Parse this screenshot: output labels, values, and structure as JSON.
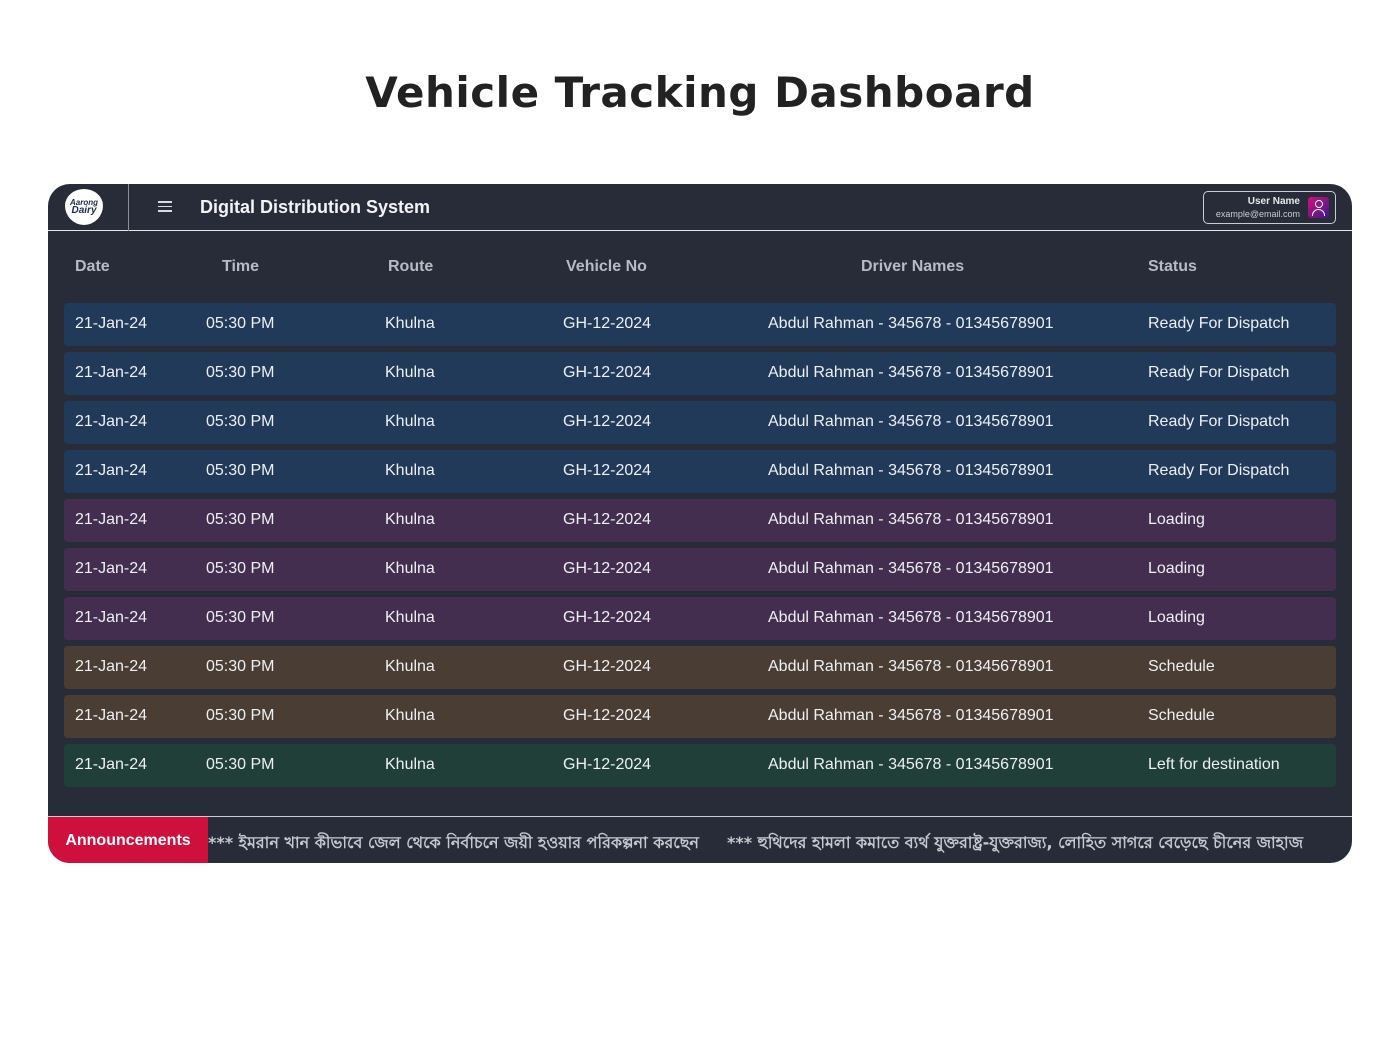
{
  "page": {
    "title": "Vehicle Tracking Dashboard"
  },
  "header": {
    "logo": {
      "line1": "Aarong",
      "line2": "Dairy"
    },
    "app_name": "Digital Distribution System",
    "menu_icon": "hamburger-icon",
    "user": {
      "name": "User Name",
      "email": "example@email.com",
      "avatar_icon": "user-avatar-icon"
    }
  },
  "table": {
    "columns": [
      "Date",
      "Time",
      "Route",
      "Vehicle No",
      "Driver Names",
      "Status"
    ],
    "rows": [
      {
        "date": "21-Jan-24",
        "time": "05:30 PM",
        "route": "Khulna",
        "vehicle": "GH-12-2024",
        "driver": "Abdul Rahman - 345678 - 01345678901",
        "status": "Ready For Dispatch"
      },
      {
        "date": "21-Jan-24",
        "time": "05:30 PM",
        "route": "Khulna",
        "vehicle": "GH-12-2024",
        "driver": "Abdul Rahman - 345678 - 01345678901",
        "status": "Ready For Dispatch"
      },
      {
        "date": "21-Jan-24",
        "time": "05:30 PM",
        "route": "Khulna",
        "vehicle": "GH-12-2024",
        "driver": "Abdul Rahman - 345678 - 01345678901",
        "status": "Ready For Dispatch"
      },
      {
        "date": "21-Jan-24",
        "time": "05:30 PM",
        "route": "Khulna",
        "vehicle": "GH-12-2024",
        "driver": "Abdul Rahman - 345678 - 01345678901",
        "status": "Ready For Dispatch"
      },
      {
        "date": "21-Jan-24",
        "time": "05:30 PM",
        "route": "Khulna",
        "vehicle": "GH-12-2024",
        "driver": "Abdul Rahman - 345678 - 01345678901",
        "status": "Loading"
      },
      {
        "date": "21-Jan-24",
        "time": "05:30 PM",
        "route": "Khulna",
        "vehicle": "GH-12-2024",
        "driver": "Abdul Rahman - 345678 - 01345678901",
        "status": "Loading"
      },
      {
        "date": "21-Jan-24",
        "time": "05:30 PM",
        "route": "Khulna",
        "vehicle": "GH-12-2024",
        "driver": "Abdul Rahman - 345678 - 01345678901",
        "status": "Loading"
      },
      {
        "date": "21-Jan-24",
        "time": "05:30 PM",
        "route": "Khulna",
        "vehicle": "GH-12-2024",
        "driver": "Abdul Rahman - 345678 - 01345678901",
        "status": "Schedule"
      },
      {
        "date": "21-Jan-24",
        "time": "05:30 PM",
        "route": "Khulna",
        "vehicle": "GH-12-2024",
        "driver": "Abdul Rahman - 345678 - 01345678901",
        "status": "Schedule"
      },
      {
        "date": "21-Jan-24",
        "time": "05:30 PM",
        "route": "Khulna",
        "vehicle": "GH-12-2024",
        "driver": "Abdul Rahman - 345678 - 01345678901",
        "status": "Left for destination"
      }
    ]
  },
  "status_colors": {
    "Ready For Dispatch": "#213a5a",
    "Loading": "#432e4f",
    "Schedule": "#4a3d33",
    "Left for destination": "#1f3f38"
  },
  "announcements": {
    "label": "Announcements",
    "items": [
      "*** ইমরান খান কীভাবে জেল থেকে নির্বাচনে জয়ী হওয়ার পরিকল্পনা করছেন",
      "*** হুথিদের হামলা কমাতে ব্যর্থ যুক্তরাষ্ট্র-যুক্তরাজ্য, লোহিত সাগরে বেড়েছে চীনের জাহাজ"
    ]
  },
  "colors": {
    "app_bg": "#272c38",
    "announcement_accent": "#d0103c"
  }
}
